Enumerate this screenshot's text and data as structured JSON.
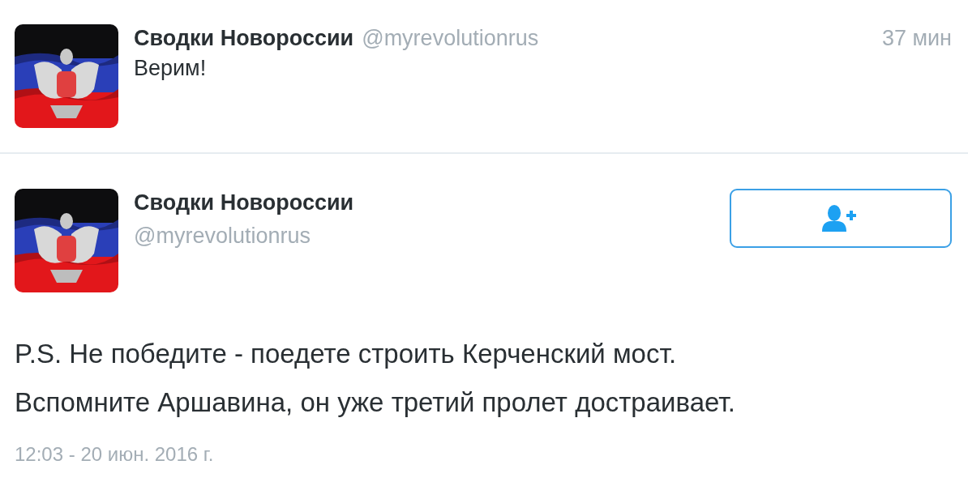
{
  "reply_tweet": {
    "author_name": "Сводки Новороссии",
    "handle": "@myrevolutionrus",
    "time": "37 мин",
    "text": "Верим!"
  },
  "tweet": {
    "author_name": "Сводки Новороссии",
    "handle": "@myrevolutionrus",
    "follow_button": {
      "following": false
    },
    "text_lines": [
      "P.S. Не победите - поедете строить Керченский мост.",
      "Вспомните Аршавина, он уже третий пролет достраивает."
    ],
    "timestamp": "12:03 - 20 июн. 2016 г."
  }
}
